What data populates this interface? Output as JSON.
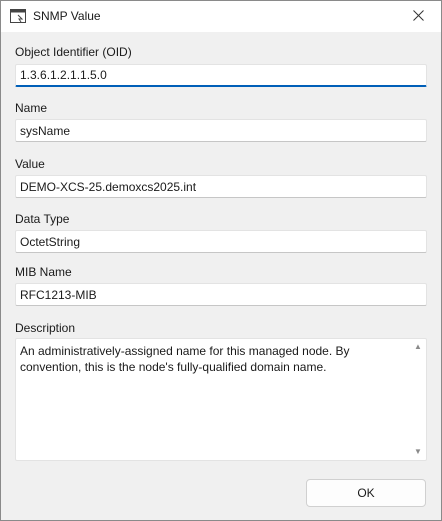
{
  "window": {
    "title": "SNMP Value",
    "icon": "snmp-value-window-icon",
    "close_icon": "close-icon"
  },
  "fields": {
    "oid": {
      "label": "Object Identifier (OID)",
      "value": "1.3.6.1.2.1.1.5.0"
    },
    "name": {
      "label": "Name",
      "value": "sysName"
    },
    "value": {
      "label": "Value",
      "value": "DEMO-XCS-25.demoxcs2025.int"
    },
    "data_type": {
      "label": "Data Type",
      "value": "OctetString"
    },
    "mib_name": {
      "label": "MIB Name",
      "value": "RFC1213-MIB"
    },
    "description": {
      "label": "Description",
      "value": "An administratively-assigned name for this managed node. By convention, this is the node's fully-qualified domain name."
    }
  },
  "buttons": {
    "ok_label": "OK"
  },
  "colors": {
    "accent": "#005fb8",
    "background": "#f0f0f0",
    "input_background": "#ffffff"
  }
}
